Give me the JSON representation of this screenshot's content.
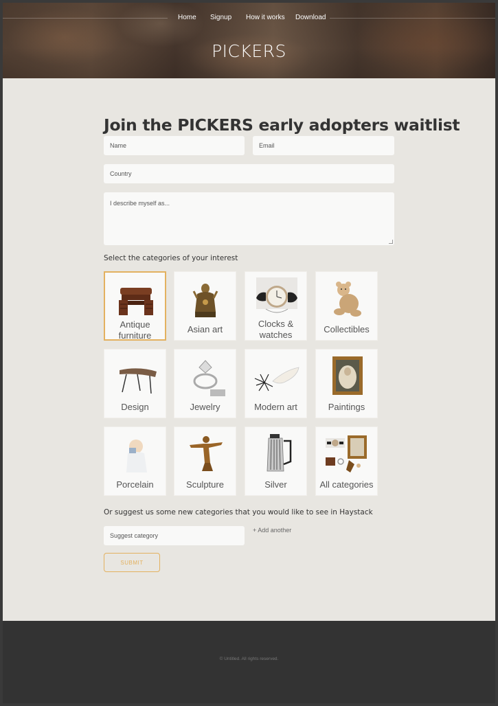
{
  "nav": {
    "items": [
      "Home",
      "Signup",
      "How it works",
      "Download"
    ]
  },
  "brand": "PICKERS",
  "form": {
    "title": "Join the PICKERS early adopters waitlist",
    "name_placeholder": "Name",
    "email_placeholder": "Email",
    "country_placeholder": "Country",
    "describe_placeholder": "I describe myself as...",
    "categories_label": "Select the categories of your interest",
    "categories": [
      {
        "label": "Antique furniture",
        "icon": "antique-desk-icon",
        "selected": true
      },
      {
        "label": "Asian art",
        "icon": "buddha-statue-icon",
        "selected": false
      },
      {
        "label": "Clocks & watches",
        "icon": "wristwatch-icon",
        "selected": false
      },
      {
        "label": "Collectibles",
        "icon": "teddy-bear-icon",
        "selected": false
      },
      {
        "label": "Design",
        "icon": "design-table-icon",
        "selected": false
      },
      {
        "label": "Jewelry",
        "icon": "diamond-ring-icon",
        "selected": false
      },
      {
        "label": "Modern art",
        "icon": "modern-sculpture-icon",
        "selected": false
      },
      {
        "label": "Paintings",
        "icon": "framed-portrait-icon",
        "selected": false
      },
      {
        "label": "Porcelain",
        "icon": "porcelain-figure-icon",
        "selected": false
      },
      {
        "label": "Sculpture",
        "icon": "bronze-statue-icon",
        "selected": false
      },
      {
        "label": "Silver",
        "icon": "silver-pitcher-icon",
        "selected": false
      },
      {
        "label": "All categories",
        "icon": "collage-icon",
        "selected": false
      }
    ],
    "suggest_label": "Or suggest us some new categories that you would like to see in Haystack",
    "suggest_placeholder": "Suggest category",
    "add_another": "+ Add another",
    "submit_label": "SUBMIT"
  },
  "footer": {
    "copyright": "© Untitled. All rights reserved."
  },
  "colors": {
    "accent": "#e3b15f",
    "page_bg": "#e8e6e1",
    "footer_bg": "#333333"
  }
}
